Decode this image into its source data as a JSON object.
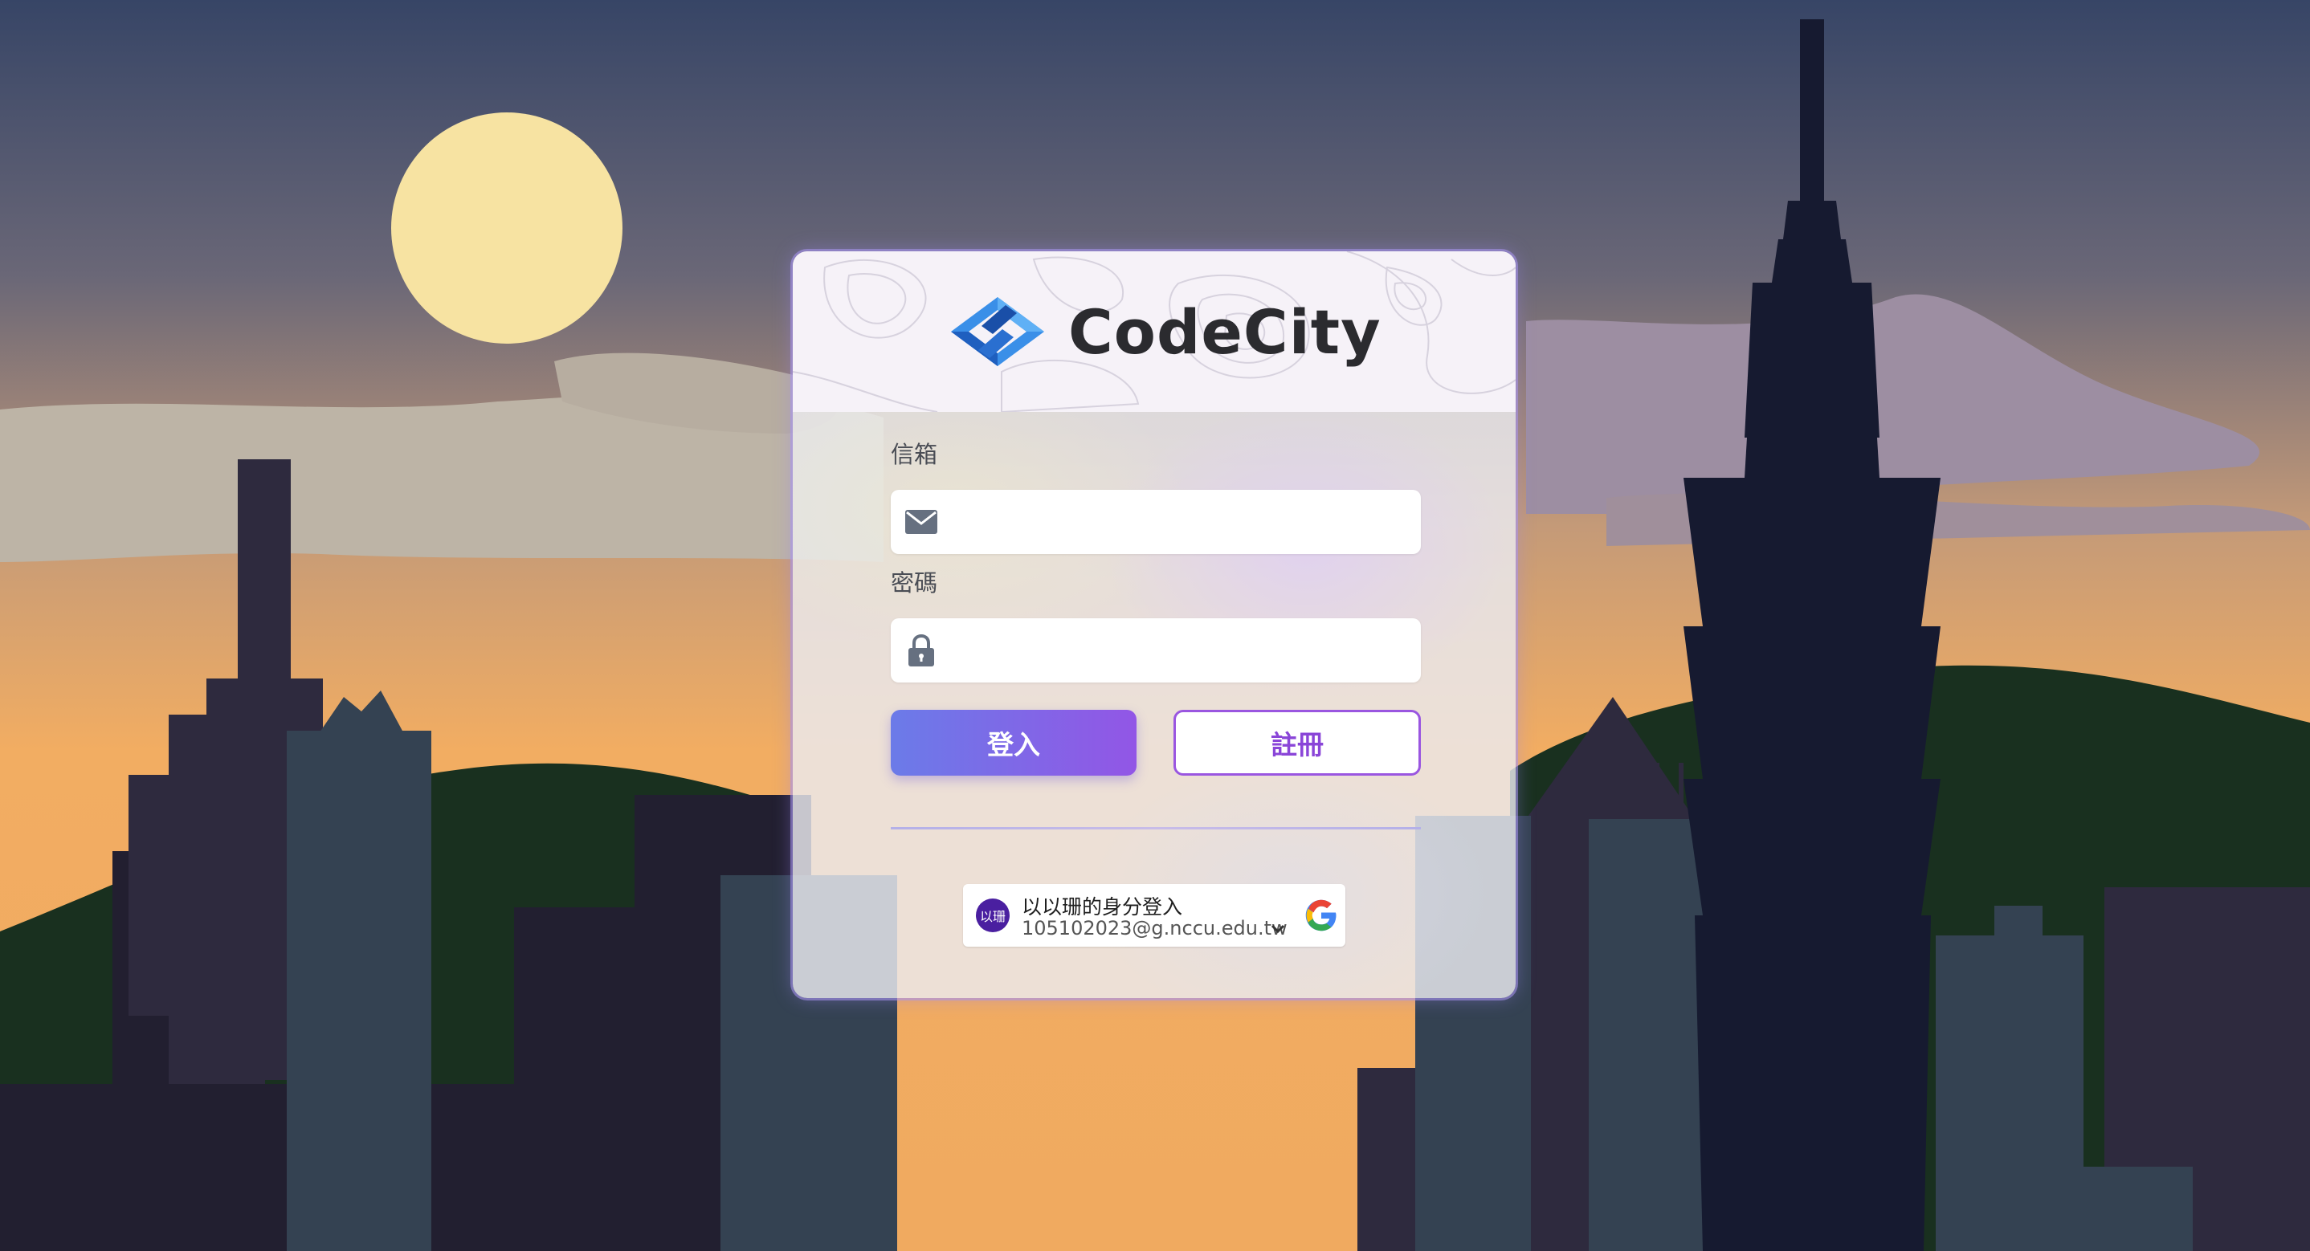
{
  "app": {
    "brand_name": "CodeCity"
  },
  "login_form": {
    "email_label": "信箱",
    "email_icon": "envelope-icon",
    "email_value": "",
    "password_label": "密碼",
    "password_icon": "lock-icon",
    "password_value": "",
    "login_button": "登入",
    "register_button": "註冊"
  },
  "google_signin": {
    "avatar_text": "以珊",
    "title": "以以珊的身分登入",
    "email": "105102023@g.nccu.edu.tw",
    "chevron_icon": "chevron-down-icon",
    "logo_icon": "google-g-icon"
  },
  "theme": {
    "sky_top": "#374566",
    "sky_glow": "#f2ad62",
    "moon": "#f7e3a2",
    "hill": "#19301f",
    "building_dark": "#221f30",
    "building_slate": "#344252",
    "tower": "#161a30",
    "accent_start": "#6b7be8",
    "accent_end": "#9256e6"
  }
}
